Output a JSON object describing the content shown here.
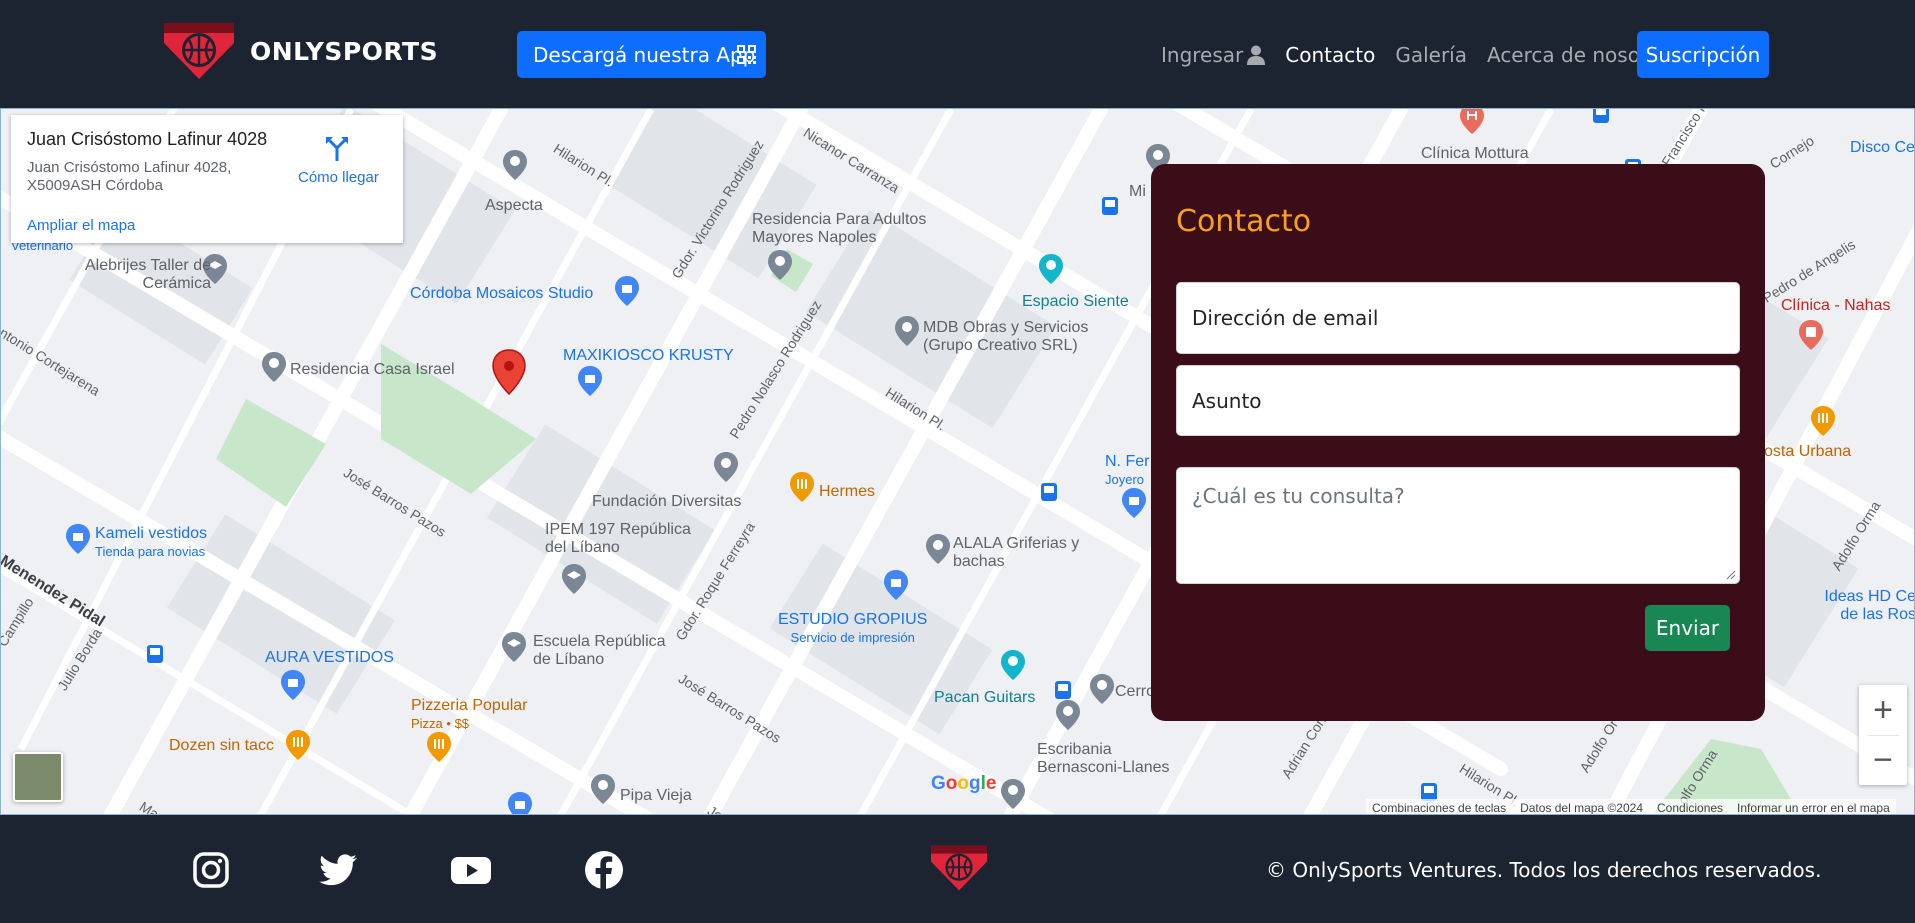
{
  "colors": {
    "navbar_bg": "#1c2331",
    "primary": "#0d6efd",
    "contact_bg": "#3b0d19",
    "contact_title": "#f7a01b",
    "success": "#198754",
    "brand_red": "#e0253a"
  },
  "navbar": {
    "brand": "ONLYSPORTS",
    "logo_icon": "basketball-shield-logo",
    "app_button": "Descargá nuestra App",
    "app_button_icon": "qr-code-icon",
    "links": [
      {
        "label": "Ingresar",
        "icon": "user-icon"
      },
      {
        "label": "Contacto",
        "active": true
      },
      {
        "label": "Galería"
      },
      {
        "label": "Acerca de nosotros"
      }
    ],
    "subscribe_button": "Suscripción"
  },
  "map": {
    "info_card": {
      "title": "Juan Crisóstomo Lafinur 4028",
      "address": "Juan Crisóstomo Lafinur 4028, X5009ASH Córdoba",
      "enlarge_link": "Ampliar el mapa",
      "directions_link": "Cómo llegar"
    },
    "places": [
      {
        "label": "Aspecta"
      },
      {
        "label": "Residencia Para Adultos Mayores Napoles"
      },
      {
        "label": "Clínica Mottura"
      },
      {
        "label": "Disco Ce"
      },
      {
        "label": "Alebrijes Taller de Cerámica"
      },
      {
        "label": "Córdoba Mosaicos Studio"
      },
      {
        "label": "Espacio Siente"
      },
      {
        "label": "MDB Obras y Servicios (Grupo Creativo SRL)"
      },
      {
        "label": "Clínica - Nahas"
      },
      {
        "label": "Residencia Casa Israel"
      },
      {
        "label": "MAXIKIOSCO KRUSTY"
      },
      {
        "label": "osta Urbana"
      },
      {
        "label": "N. Fer",
        "sub": "Joyero"
      },
      {
        "label": "Hermes"
      },
      {
        "label": "Fundación Diversitas"
      },
      {
        "label": "IPEM 197 República del Líbano"
      },
      {
        "label": "ALALA Griferias y bachas"
      },
      {
        "label": "Kameli vestidos",
        "sub": "Tienda para novias"
      },
      {
        "label": "ESTUDIO GROPIUS",
        "sub": "Servicio de impresión"
      },
      {
        "label": "Ideas HD Ce de las Ros"
      },
      {
        "label": "AURA VESTIDOS"
      },
      {
        "label": "Escuela República de Líbano"
      },
      {
        "label": "Pacan Guitars"
      },
      {
        "label": "Cerro"
      },
      {
        "label": "Pizzeria Popular",
        "sub": "Pizza • $$"
      },
      {
        "label": "Dozen sin tacc"
      },
      {
        "label": "Escribania Bernasconi-Llanes"
      },
      {
        "label": "Pipa Vieja"
      },
      {
        "label": "Mi"
      },
      {
        "label": "Veterinario"
      }
    ],
    "streets": [
      {
        "label": "Hilarion Pl."
      },
      {
        "label": "Nicanor Carranza"
      },
      {
        "label": "Gdor. Victorino Rodriguez"
      },
      {
        "label": "Pedro Nolasco Rodriguez"
      },
      {
        "label": "Hilarion Pl."
      },
      {
        "label": "ntonio Cortejarena"
      },
      {
        "label": "José Barros Pazos"
      },
      {
        "label": "Menendez Pidal"
      },
      {
        "label": "Gdor. Roque Ferreyra"
      },
      {
        "label": "José Barros Pazos"
      },
      {
        "label": "Julio Borda"
      },
      {
        "label": "Campillo"
      },
      {
        "label": "Francisco Pere"
      },
      {
        "label": "Cornejo"
      },
      {
        "label": "Pedro de Angelis"
      },
      {
        "label": "Adolfo Orma"
      },
      {
        "label": "Adrian Cornejo"
      },
      {
        "label": "Hilarion Pl."
      },
      {
        "label": "Adolfo Or"
      },
      {
        "label": "olfo Orma"
      },
      {
        "label": "Marti"
      },
      {
        "label": "Jose"
      }
    ],
    "zoom_in": "+",
    "zoom_out": "−",
    "google_logo": "Google",
    "attribution": [
      "Combinaciones de teclas",
      "Datos del mapa ©2024",
      "Condiciones",
      "Informar un error en el mapa"
    ]
  },
  "contact": {
    "title": "Contacto",
    "email_placeholder": "Dirección de email",
    "subject_placeholder": "Asunto",
    "message_placeholder": "¿Cuál es tu consulta?",
    "submit": "Enviar"
  },
  "footer": {
    "social_icons": [
      "instagram-icon",
      "twitter-icon",
      "youtube-icon",
      "facebook-icon"
    ],
    "copyright": "© OnlySports Ventures. Todos los derechos reservados."
  }
}
